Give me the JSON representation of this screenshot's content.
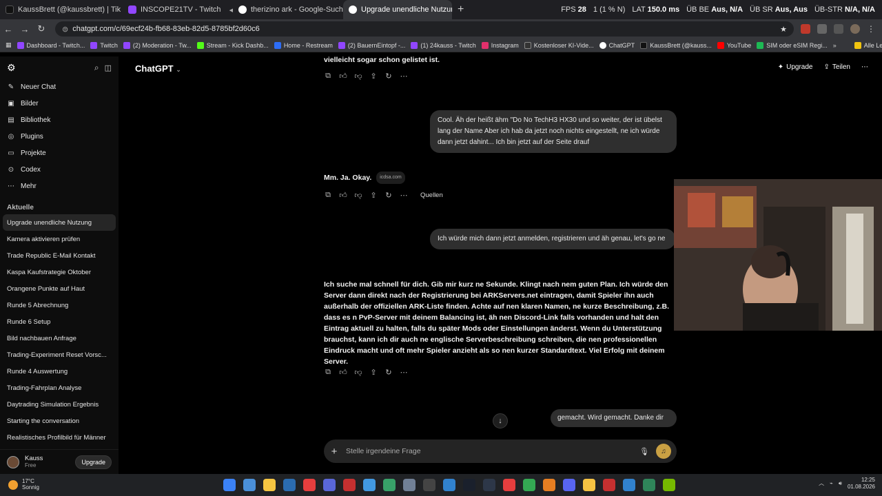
{
  "browser": {
    "tabs": [
      {
        "label": "KaussBrett (@kaussbrett) | Tik",
        "color": "#111111"
      },
      {
        "label": "INSCOPE21TV - Twitch",
        "color": "#9146ff"
      },
      {
        "label": "therizino ark - Google-Suche",
        "color": "#4285f4"
      },
      {
        "label": "Upgrade unendliche Nutzung",
        "color": "#ffffff"
      }
    ],
    "stats": {
      "fps_label": "FPS",
      "fps_value": "28",
      "drop": "1 (1 % N)",
      "lat_label": "LAT",
      "lat_value": "150.0 ms",
      "ub_be": "ÜB BE",
      "ub_be_value": "Aus, N/A",
      "ub_sr": "ÜB SR",
      "ub_sr_value": "Aus, Aus",
      "ub_str": "ÜB-STR",
      "ub_str_value": "N/A, N/A"
    },
    "url": "chatgpt.com/c/69ecf24b-fb68-83eb-82d5-8785bf2d60c6",
    "bookmarks": [
      {
        "label": "Dashboard - Twitch...",
        "color": "#9146ff"
      },
      {
        "label": "Twitch",
        "color": "#9146ff"
      },
      {
        "label": "(2) Moderation - Tw...",
        "color": "#9146ff"
      },
      {
        "label": "Stream - Kick Dashb...",
        "color": "#53fc18"
      },
      {
        "label": "Home - Restream",
        "color": "#2d6df6"
      },
      {
        "label": "(2) BauernEintopf -...",
        "color": "#9146ff"
      },
      {
        "label": "(1) 24kauss - Twitch",
        "color": "#9146ff"
      },
      {
        "label": "Instagram",
        "color": "#e1306c"
      },
      {
        "label": "Kostenloser KI-Vide...",
        "color": "#333333"
      },
      {
        "label": "ChatGPT",
        "color": "#ffffff"
      },
      {
        "label": "KaussBrett (@kauss...",
        "color": "#111111"
      },
      {
        "label": "YouTube",
        "color": "#ff0000"
      },
      {
        "label": "SIM oder eSIM Regi...",
        "color": "#1db954"
      },
      {
        "label": "Alle Lesezeichen",
        "color": "#f1c40f"
      }
    ]
  },
  "sidebar": {
    "nav": [
      {
        "label": "Neuer Chat",
        "icon": "✎"
      },
      {
        "label": "Bilder",
        "icon": "▣"
      },
      {
        "label": "Bibliothek",
        "icon": "▤"
      },
      {
        "label": "Plugins",
        "icon": "◎"
      },
      {
        "label": "Projekte",
        "icon": "▭"
      },
      {
        "label": "Codex",
        "icon": "⊙"
      },
      {
        "label": "Mehr",
        "icon": "⋯"
      }
    ],
    "section_label": "Aktuelle",
    "chats": [
      "Upgrade unendliche Nutzung",
      "Kamera aktivieren prüfen",
      "Trade Republic E-Mail Kontakt",
      "Kaspa Kaufstrategie Oktober",
      "Orangene Punkte auf Haut",
      "Runde 5 Abrechnung",
      "Runde 6 Setup",
      "Bild nachbauen Anfrage",
      "Trading-Experiment Reset Vorsc...",
      "Runde 4 Auswertung",
      "Trading-Fahrplan Analyse",
      "Daytrading Simulation Ergebnis",
      "Starting the conversation",
      "Realistisches Profilbild für Männer"
    ],
    "user": {
      "name": "Kauss",
      "plan": "Free",
      "upgrade_label": "Upgrade"
    }
  },
  "header": {
    "model": "ChatGPT",
    "upgrade": "Upgrade",
    "share": "Teilen"
  },
  "conversation": {
    "top_text": "vielleicht sogar schon gelistet ist.",
    "user_msg_1": "Cool. Äh der heißt ähm \"Do No TechH3 HX30 und so weiter, der ist übelst lang der Name Aber ich hab da jetzt noch nichts eingestellt, ne ich würde dann jetzt dahint... Ich bin jetzt auf der Seite drauf",
    "assistant_msg_1": "Mm. Ja. Okay.",
    "source_chip": "icdsa.com",
    "sources_label": "Quellen",
    "user_msg_2": "Ich würde mich dann jetzt anmelden, registrieren und äh genau, let's go ne",
    "assistant_msg_2": "Ich suche mal schnell für dich. Gib mir kurz ne Sekunde. Klingt nach nem guten Plan. Ich würde den Server dann direkt nach der Registrierung bei ARKServers.net eintragen, damit Spieler ihn auch außerhalb der offiziellen ARK-Liste finden. Achte auf nen klaren Namen, ne kurze Beschreibung, z.B. dass es n PvP-Server mit deinem Balancing ist, äh nen Discord-Link falls vorhanden und halt den Eintrag aktuell zu halten, falls du später Mods oder Einstellungen änderst. Wenn du Unterstützung brauchst, kann ich dir auch ne englische Serverbeschreibung schreiben, die nen professionellen Eindruck macht und oft mehr Spieler anzieht als so nen kurzer Standardtext. Viel Erfolg mit deinem Server.",
    "user_msg_3": "gemacht. Wird gemacht. Danke dir"
  },
  "composer": {
    "placeholder": "Stelle irgendeine Frage"
  },
  "taskbar": {
    "weather_temp": "17°C",
    "weather_desc": "Sonnig",
    "time": "12:25",
    "date": "01.08.2026",
    "app_colors": [
      "#3b82f6",
      "#4a90d9",
      "#f5c542",
      "#2b6cb0",
      "#e53e3e",
      "#5a67d8",
      "#c53030",
      "#4299e1",
      "#38a169",
      "#718096",
      "#444444",
      "#3182ce",
      "#1a202c",
      "#2d3748",
      "#e53e3e",
      "#34a853",
      "#e67e22",
      "#5865f2",
      "#f6c343",
      "#c53030",
      "#3182ce",
      "#2f855a",
      "#76b900"
    ]
  }
}
